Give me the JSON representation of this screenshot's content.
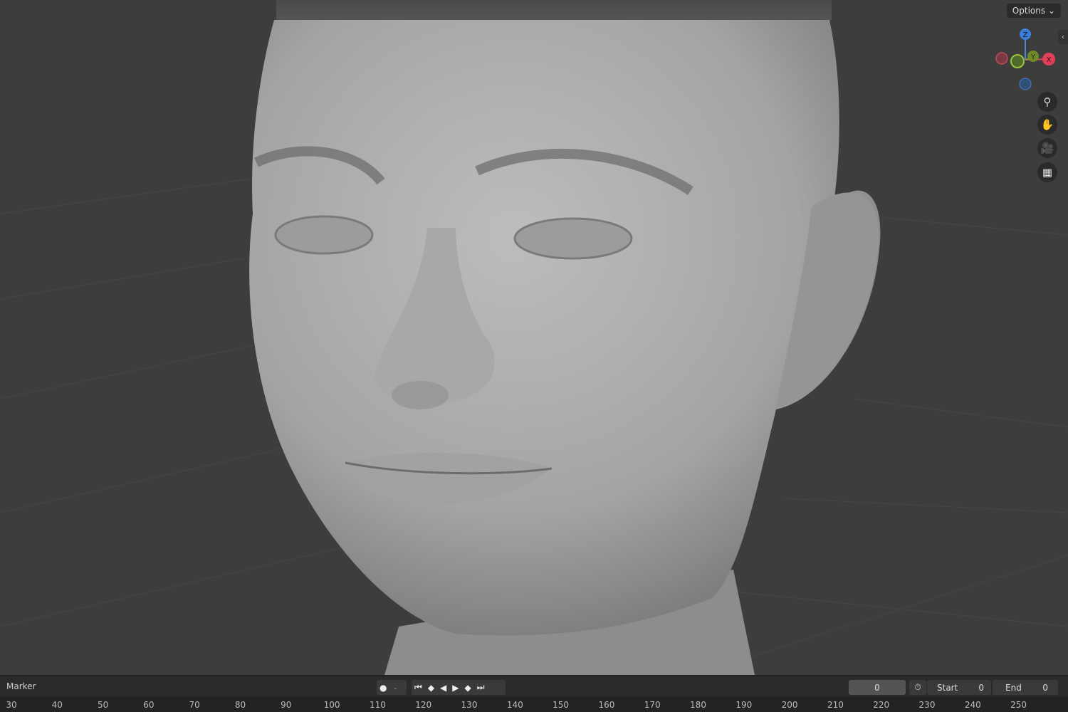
{
  "viewport": {
    "options_label": "Options",
    "gizmo": {
      "z": "Z",
      "y": "Y",
      "x": "X"
    },
    "nav_icons": [
      "zoom-icon",
      "hand-pan-icon",
      "camera-icon",
      "grid-ortho-icon"
    ]
  },
  "timeline": {
    "marker_label": "Marker",
    "current_frame": "0",
    "start_label": "Start",
    "start_value": "0",
    "end_label": "End",
    "end_value": "0",
    "ruler_ticks": [
      "30",
      "40",
      "50",
      "60",
      "70",
      "80",
      "90",
      "100",
      "110",
      "120",
      "130",
      "140",
      "150",
      "160",
      "170",
      "180",
      "190",
      "200",
      "210",
      "220",
      "230",
      "240",
      "250"
    ]
  }
}
